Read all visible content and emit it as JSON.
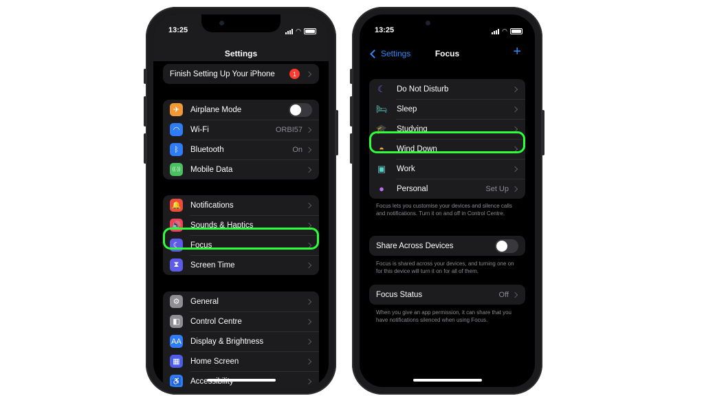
{
  "left_phone": {
    "status_time": "13:25",
    "title": "Settings",
    "setup_row": {
      "label": "Finish Setting Up Your iPhone",
      "badge": "1"
    },
    "group1": [
      {
        "label": "Airplane Mode",
        "value": "",
        "icon": "airplane-icon",
        "glyph": "✈",
        "color": "#f09a37",
        "toggle": true
      },
      {
        "label": "Wi-Fi",
        "value": "ORBI57",
        "icon": "wifi-icon",
        "glyph": "◠",
        "color": "#2f7cf6"
      },
      {
        "label": "Bluetooth",
        "value": "On",
        "icon": "bluetooth-icon",
        "glyph": "ᛒ",
        "color": "#2f7cf6"
      },
      {
        "label": "Mobile Data",
        "value": "",
        "icon": "antenna-icon",
        "glyph": "((·))",
        "color": "#4cc061"
      }
    ],
    "group2": [
      {
        "label": "Notifications",
        "value": "",
        "icon": "bell-icon",
        "glyph": "🔔",
        "color": "#eb4d3d"
      },
      {
        "label": "Sounds & Haptics",
        "value": "",
        "icon": "speaker-icon",
        "glyph": "🔊",
        "color": "#eb445a"
      },
      {
        "label": "Focus",
        "value": "",
        "icon": "moon-icon",
        "glyph": "☾",
        "color": "#5e5ce6"
      },
      {
        "label": "Screen Time",
        "value": "",
        "icon": "hourglass-icon",
        "glyph": "⧗",
        "color": "#5e5ce6"
      }
    ],
    "group3": [
      {
        "label": "General",
        "value": "",
        "icon": "gear-icon",
        "glyph": "⚙",
        "color": "#8e8e93"
      },
      {
        "label": "Control Centre",
        "value": "",
        "icon": "switches-icon",
        "glyph": "◧",
        "color": "#8e8e93"
      },
      {
        "label": "Display & Brightness",
        "value": "",
        "icon": "display-icon",
        "glyph": "AA",
        "color": "#2f7cf6"
      },
      {
        "label": "Home Screen",
        "value": "",
        "icon": "grid-icon",
        "glyph": "▦",
        "color": "#4d5de8"
      },
      {
        "label": "Accessibility",
        "value": "",
        "icon": "accessibility-icon",
        "glyph": "♿",
        "color": "#2f7cf6"
      }
    ]
  },
  "right_phone": {
    "status_time": "13:25",
    "back_label": "Settings",
    "title": "Focus",
    "focus_modes": [
      {
        "label": "Do Not Disturb",
        "value": "",
        "icon": "moon-icon",
        "glyph": "☾",
        "color": "#7d6bf5"
      },
      {
        "label": "Sleep",
        "value": "",
        "icon": "bed-icon",
        "glyph": "🛏",
        "color": "#5ed0c7"
      },
      {
        "label": "Studying",
        "value": "",
        "icon": "graduation-cap-icon",
        "glyph": "🎓",
        "color": "#f0a43a"
      },
      {
        "label": "Wind Down",
        "value": "",
        "icon": "sunset-icon",
        "glyph": "◓",
        "color": "#f0a43a"
      },
      {
        "label": "Work",
        "value": "",
        "icon": "badge-icon",
        "glyph": "▣",
        "color": "#5ed0c7"
      },
      {
        "label": "Personal",
        "value": "Set Up",
        "icon": "person-icon",
        "glyph": "●",
        "color": "#b66ef2"
      }
    ],
    "focus_note": "Focus lets you customise your devices and silence calls and notifications. Turn it on and off in Control Centre.",
    "share_label": "Share Across Devices",
    "share_note": "Focus is shared across your devices, and turning one on for this device will turn it on for all of them.",
    "status_label": "Focus Status",
    "status_value": "Off",
    "status_note": "When you give an app permission, it can share that you have notifications silenced when using Focus."
  }
}
